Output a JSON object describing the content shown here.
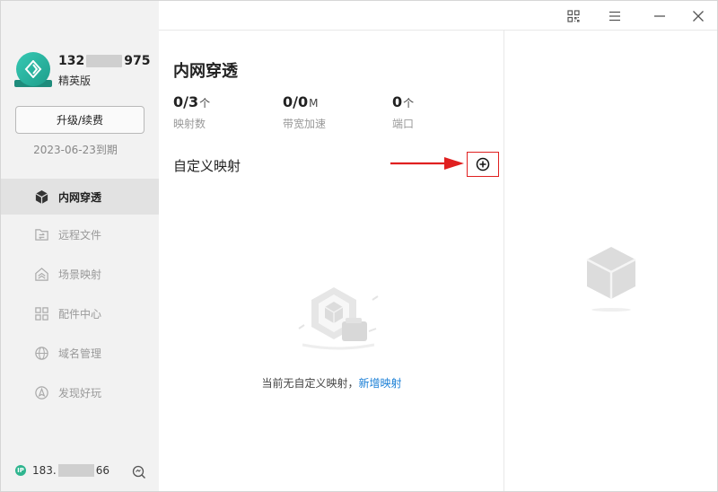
{
  "user": {
    "phone_prefix": "132",
    "phone_suffix": "975",
    "tier": "精英版",
    "upgrade_label": "升级/续费",
    "expiry": "2023-06-23到期"
  },
  "nav": {
    "items": [
      {
        "label": "内网穿透",
        "icon": "cube-icon",
        "active": true
      },
      {
        "label": "远程文件",
        "icon": "folder-transfer-icon",
        "active": false
      },
      {
        "label": "场景映射",
        "icon": "house-layers-icon",
        "active": false
      },
      {
        "label": "配件中心",
        "icon": "grid-icon",
        "active": false
      },
      {
        "label": "域名管理",
        "icon": "globe-icon",
        "active": false
      },
      {
        "label": "发现好玩",
        "icon": "compass-icon",
        "active": false
      }
    ]
  },
  "footer": {
    "ip_badge": "IP",
    "ip_prefix": "183.",
    "ip_suffix": "66"
  },
  "main": {
    "title": "内网穿透",
    "stats": [
      {
        "value": "0/3",
        "unit": "个",
        "label": "映射数"
      },
      {
        "value": "0/0",
        "unit": "M",
        "label": "带宽加速"
      },
      {
        "value": "0",
        "unit": "个",
        "label": "端口"
      }
    ],
    "section_title": "自定义映射",
    "empty_text": "当前无自定义映射，",
    "empty_link": "新增映射"
  },
  "colors": {
    "accent_link": "#1a7fd6",
    "highlight_red": "#e02020",
    "sidebar_bg": "#f2f2f2",
    "brand_teal": "#2fb58f"
  },
  "titlebar_icons": [
    "qr-code-icon",
    "menu-icon",
    "minimize-icon",
    "close-icon"
  ]
}
